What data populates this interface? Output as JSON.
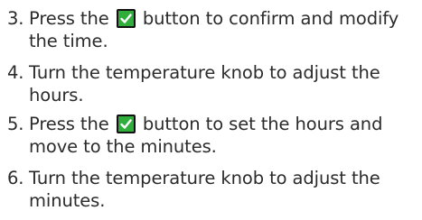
{
  "steps": [
    {
      "number": "3.",
      "text_before": "Press the",
      "icon": "check-button-icon",
      "text_after": "button to confirm and modify the time."
    },
    {
      "number": "4.",
      "text": "Turn the temperature knob to adjust the hours."
    },
    {
      "number": "5.",
      "text_before": "Press the",
      "icon": "check-button-icon",
      "text_after": "button to set the hours and move to the minutes."
    },
    {
      "number": "6.",
      "text": "Turn the temperature knob to adjust the minutes."
    }
  ],
  "colors": {
    "text": "#2b2b2b",
    "check_button_fill": "#2fae3b",
    "check_button_border": "#111111",
    "check_mark": "#ffffff"
  }
}
